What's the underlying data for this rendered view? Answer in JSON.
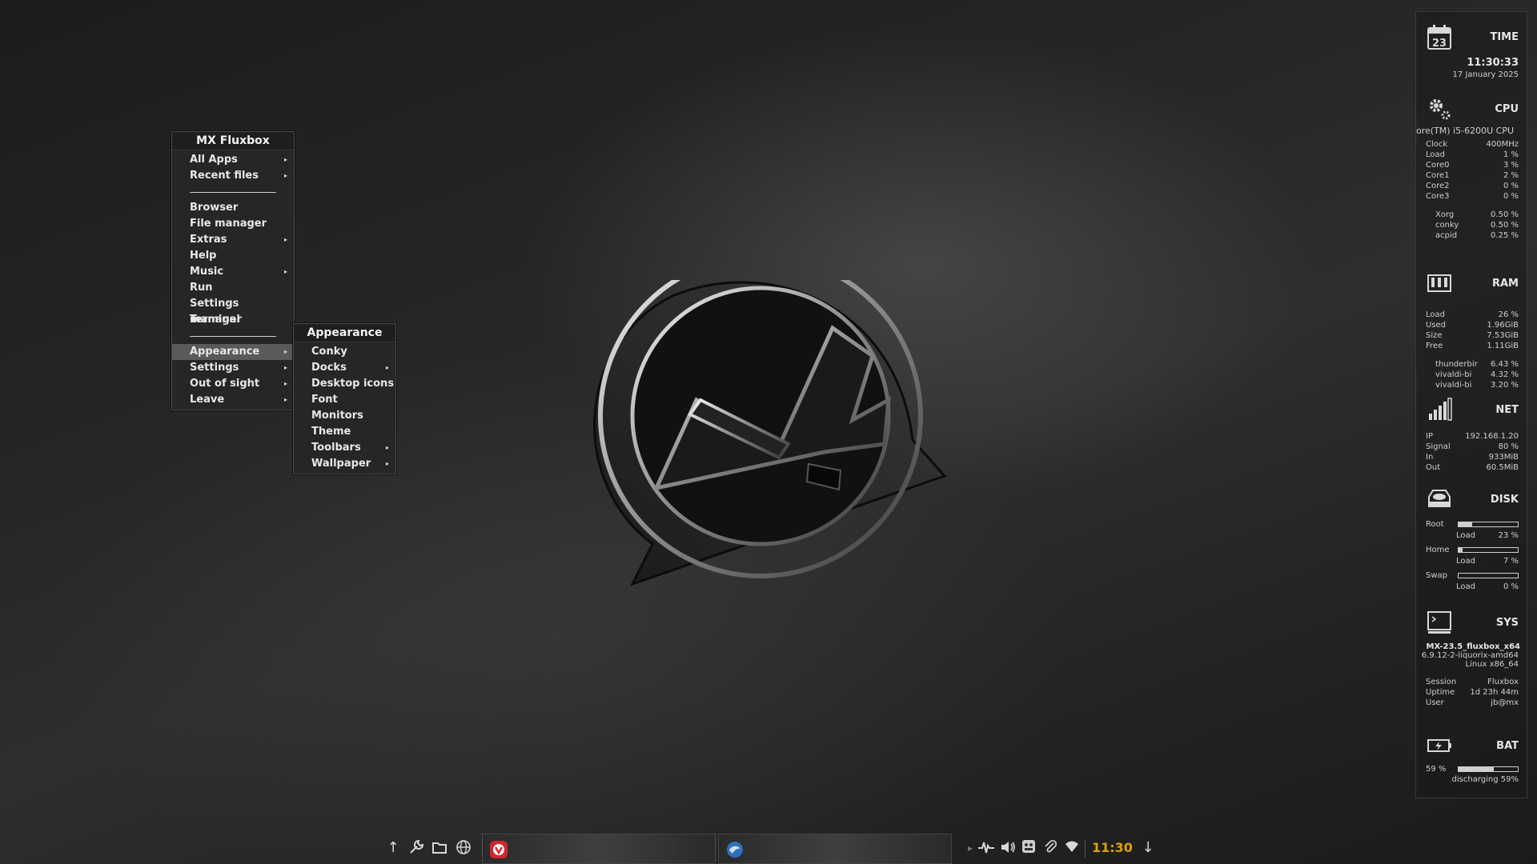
{
  "menu": {
    "title": "MX Fluxbox",
    "items": [
      {
        "label": "All Apps",
        "submenu": true
      },
      {
        "label": "Recent files",
        "submenu": true
      },
      {
        "separator": true
      },
      {
        "label": "Browser"
      },
      {
        "label": "File manager"
      },
      {
        "label": "Extras",
        "submenu": true
      },
      {
        "label": "Help"
      },
      {
        "label": "Music",
        "submenu": true
      },
      {
        "label": "Run"
      },
      {
        "label": "Settings manager"
      },
      {
        "label": "Terminal"
      },
      {
        "separator": true
      },
      {
        "label": "Appearance",
        "submenu": true,
        "active": true
      },
      {
        "label": "Settings",
        "submenu": true
      },
      {
        "label": "Out of sight",
        "submenu": true
      },
      {
        "label": "Leave",
        "submenu": true
      }
    ]
  },
  "submenu": {
    "title": "Appearance",
    "items": [
      {
        "label": "Conky"
      },
      {
        "label": "Docks",
        "submenu": true
      },
      {
        "label": "Desktop icons"
      },
      {
        "label": "Font"
      },
      {
        "label": "Monitors"
      },
      {
        "label": "Theme"
      },
      {
        "label": "Toolbars",
        "submenu": true
      },
      {
        "label": "Wallpaper",
        "submenu": true
      }
    ]
  },
  "conky": {
    "time": {
      "title": "TIME",
      "calendar_day": "23",
      "clock": "11:30:33",
      "date": "17 January 2025"
    },
    "cpu": {
      "title": "CPU",
      "model": "ore(TM) i5-6200U CPU",
      "stats": [
        {
          "k": "Clock",
          "v": "400MHz"
        },
        {
          "k": "Load",
          "v": "1 %"
        },
        {
          "k": "Core0",
          "v": "3 %"
        },
        {
          "k": "Core1",
          "v": "2 %"
        },
        {
          "k": "Core2",
          "v": "0 %"
        },
        {
          "k": "Core3",
          "v": "0 %"
        }
      ],
      "procs": [
        {
          "k": "Xorg",
          "v": "0.50 %"
        },
        {
          "k": "conky",
          "v": "0.50 %"
        },
        {
          "k": "acpid",
          "v": "0.25 %"
        }
      ]
    },
    "ram": {
      "title": "RAM",
      "stats": [
        {
          "k": "Load",
          "v": "26 %"
        },
        {
          "k": "Used",
          "v": "1.96GiB"
        },
        {
          "k": "Size",
          "v": "7.53GiB"
        },
        {
          "k": "Free",
          "v": "1.11GiB"
        }
      ],
      "procs": [
        {
          "k": "thunderbir",
          "v": "6.43 %"
        },
        {
          "k": "vivaldi-bi",
          "v": "4.32 %"
        },
        {
          "k": "vivaldi-bi",
          "v": "3.20 %"
        }
      ]
    },
    "net": {
      "title": "NET",
      "stats": [
        {
          "k": "IP",
          "v": "192.168.1.20"
        },
        {
          "k": "Signal",
          "v": "80  %"
        },
        {
          "k": "In",
          "v": "933MiB"
        },
        {
          "k": "Out",
          "v": "60.5MiB"
        }
      ]
    },
    "disk": {
      "title": "DISK",
      "entries": [
        {
          "name": "Root",
          "load_label": "Load",
          "load": "23 %",
          "fraction": 0.23
        },
        {
          "name": "Home",
          "load_label": "Load",
          "load": "7  %",
          "fraction": 0.07
        },
        {
          "name": "Swap",
          "load_label": "Load",
          "load": "0  %",
          "fraction": 0.0
        }
      ]
    },
    "sys": {
      "title": "SYS",
      "distro": "MX-23.5_fluxbox_x64",
      "kernel": "6.9.12-2-liquorix-amd64",
      "arch": "Linux x86_64",
      "stats": [
        {
          "k": "Session",
          "v": "Fluxbox"
        },
        {
          "k": "Uptime",
          "v": "1d 23h 44m"
        },
        {
          "k": "User",
          "v": "jb@mx"
        }
      ]
    },
    "bat": {
      "title": "BAT",
      "percent": "59 %",
      "fraction": 0.59,
      "status": "discharging 59%"
    }
  },
  "taskbar": {
    "clock": "11:30",
    "clock_color": "#e0a100"
  }
}
